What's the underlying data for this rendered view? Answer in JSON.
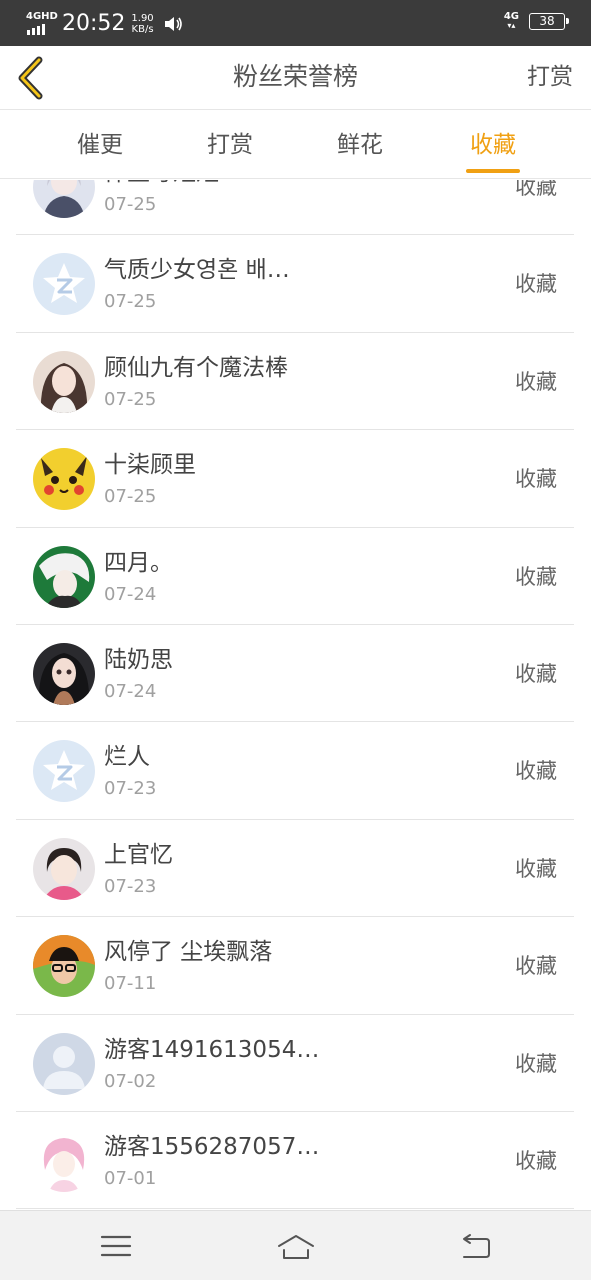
{
  "status_bar": {
    "network": "4GHD",
    "time": "20:52",
    "speed_value": "1.90",
    "speed_unit": "KB/s",
    "network_right": "4G",
    "battery": "38"
  },
  "header": {
    "back_icon": "chevron-left-icon",
    "title": "粉丝荣誉榜",
    "right_action": "打赏",
    "accent_color": "#f0a013"
  },
  "tabs": [
    {
      "label": "催更",
      "active": false
    },
    {
      "label": "打赏",
      "active": false
    },
    {
      "label": "鲜花",
      "active": false
    },
    {
      "label": "收藏",
      "active": true
    }
  ],
  "list": [
    {
      "name": "仟生写短短",
      "date": "07-25",
      "action": "收藏",
      "avatar": "anime-girl-avatar"
    },
    {
      "name": "气质少女영혼 배…",
      "date": "07-25",
      "action": "收藏",
      "avatar": "default-qq-avatar"
    },
    {
      "name": "顾仙九有个魔法棒",
      "date": "07-25",
      "action": "收藏",
      "avatar": "photo-avatar"
    },
    {
      "name": "十柒顾里",
      "date": "07-25",
      "action": "收藏",
      "avatar": "pikachu-avatar"
    },
    {
      "name": "四月。",
      "date": "07-24",
      "action": "收藏",
      "avatar": "anime-character-avatar"
    },
    {
      "name": "陆奶思",
      "date": "07-24",
      "action": "收藏",
      "avatar": "doll-avatar"
    },
    {
      "name": "烂人",
      "date": "07-23",
      "action": "收藏",
      "avatar": "default-qq-avatar"
    },
    {
      "name": "上官忆",
      "date": "07-23",
      "action": "收藏",
      "avatar": "child-photo-avatar"
    },
    {
      "name": "风停了 尘埃飘落",
      "date": "07-11",
      "action": "收藏",
      "avatar": "glasses-photo-avatar"
    },
    {
      "name": "游客1491613054…",
      "date": "07-02",
      "action": "收藏",
      "avatar": "default-person-avatar"
    },
    {
      "name": "游客1556287057…",
      "date": "07-01",
      "action": "收藏",
      "avatar": "pink-hair-avatar"
    }
  ],
  "nav": {
    "menu_icon": "menu-icon",
    "home_icon": "home-icon",
    "back_icon": "back-arrow-icon"
  }
}
